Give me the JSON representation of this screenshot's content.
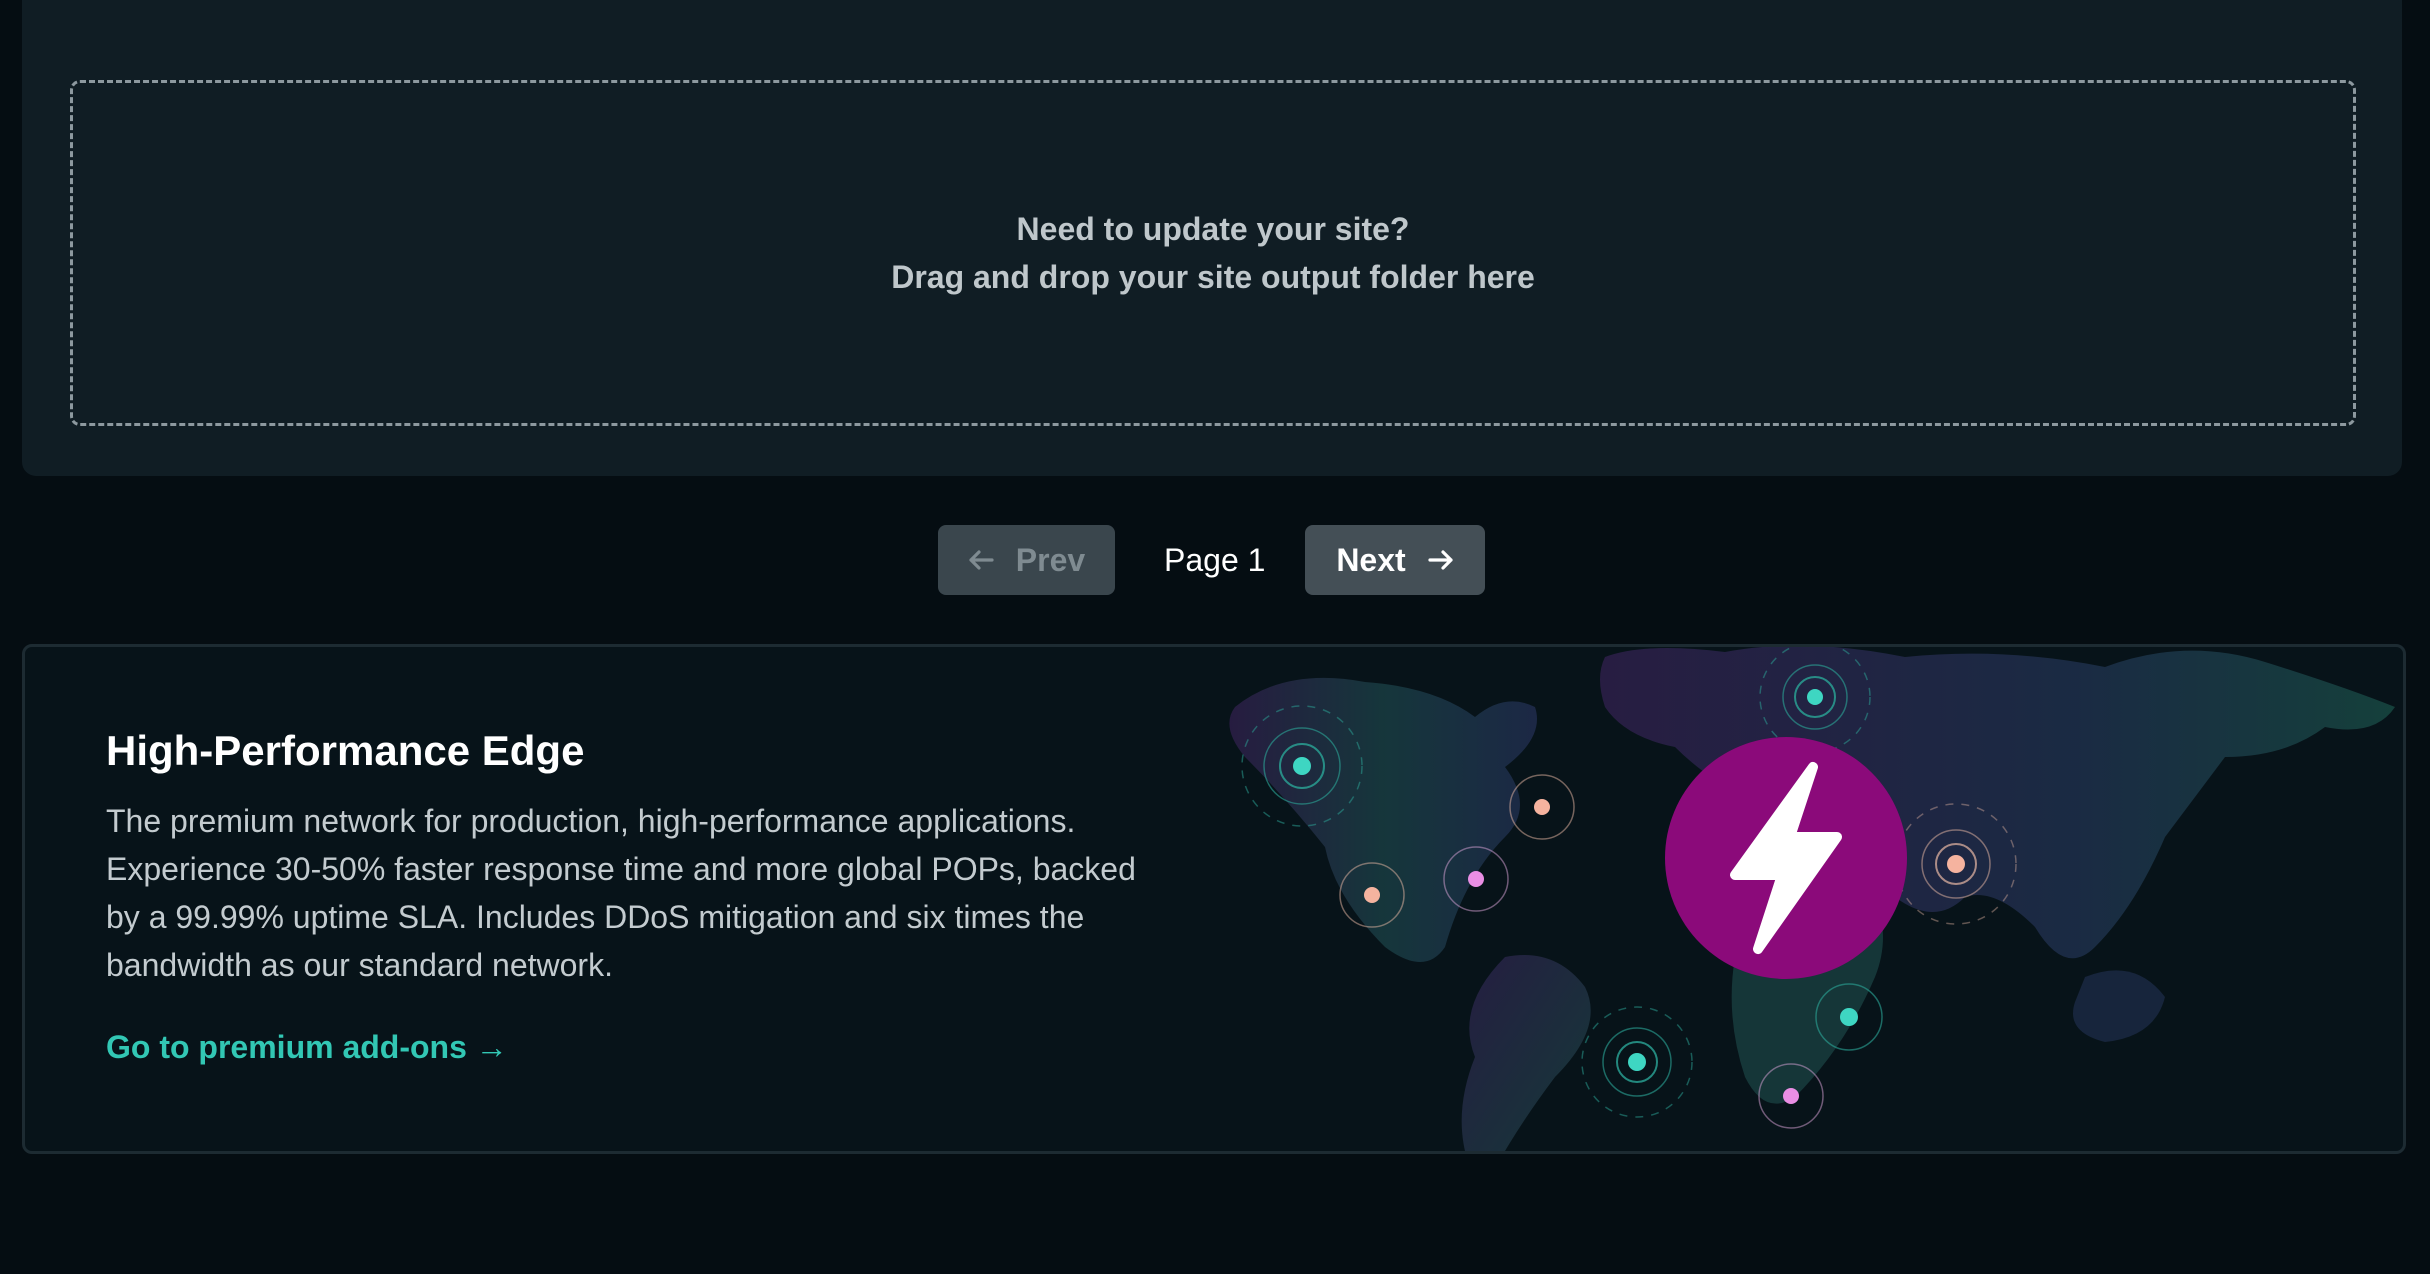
{
  "dropzone": {
    "line1": "Need to update your site?",
    "line2": "Drag and drop your site output folder here"
  },
  "pagination": {
    "prev_label": "Prev",
    "page_label": "Page 1",
    "next_label": "Next",
    "prev_icon": "arrow-left-icon",
    "next_icon": "arrow-right-icon"
  },
  "promo": {
    "title": "High-Performance Edge",
    "body": "The premium network for production, high-performance applications. Experience 30-50% faster response time and more global POPs, backed by a 99.99% uptime SLA. Includes DDoS mitigation and six times the bandwidth as our standard network.",
    "link_label": "Go to premium add-ons →",
    "illustration": "world-map-with-edge-nodes",
    "badge_icon": "lightning-bolt-icon"
  },
  "colors": {
    "accent": "#32c7b4",
    "badge": "#8b0a7a",
    "background": "#050d12",
    "card": "#101d24"
  }
}
